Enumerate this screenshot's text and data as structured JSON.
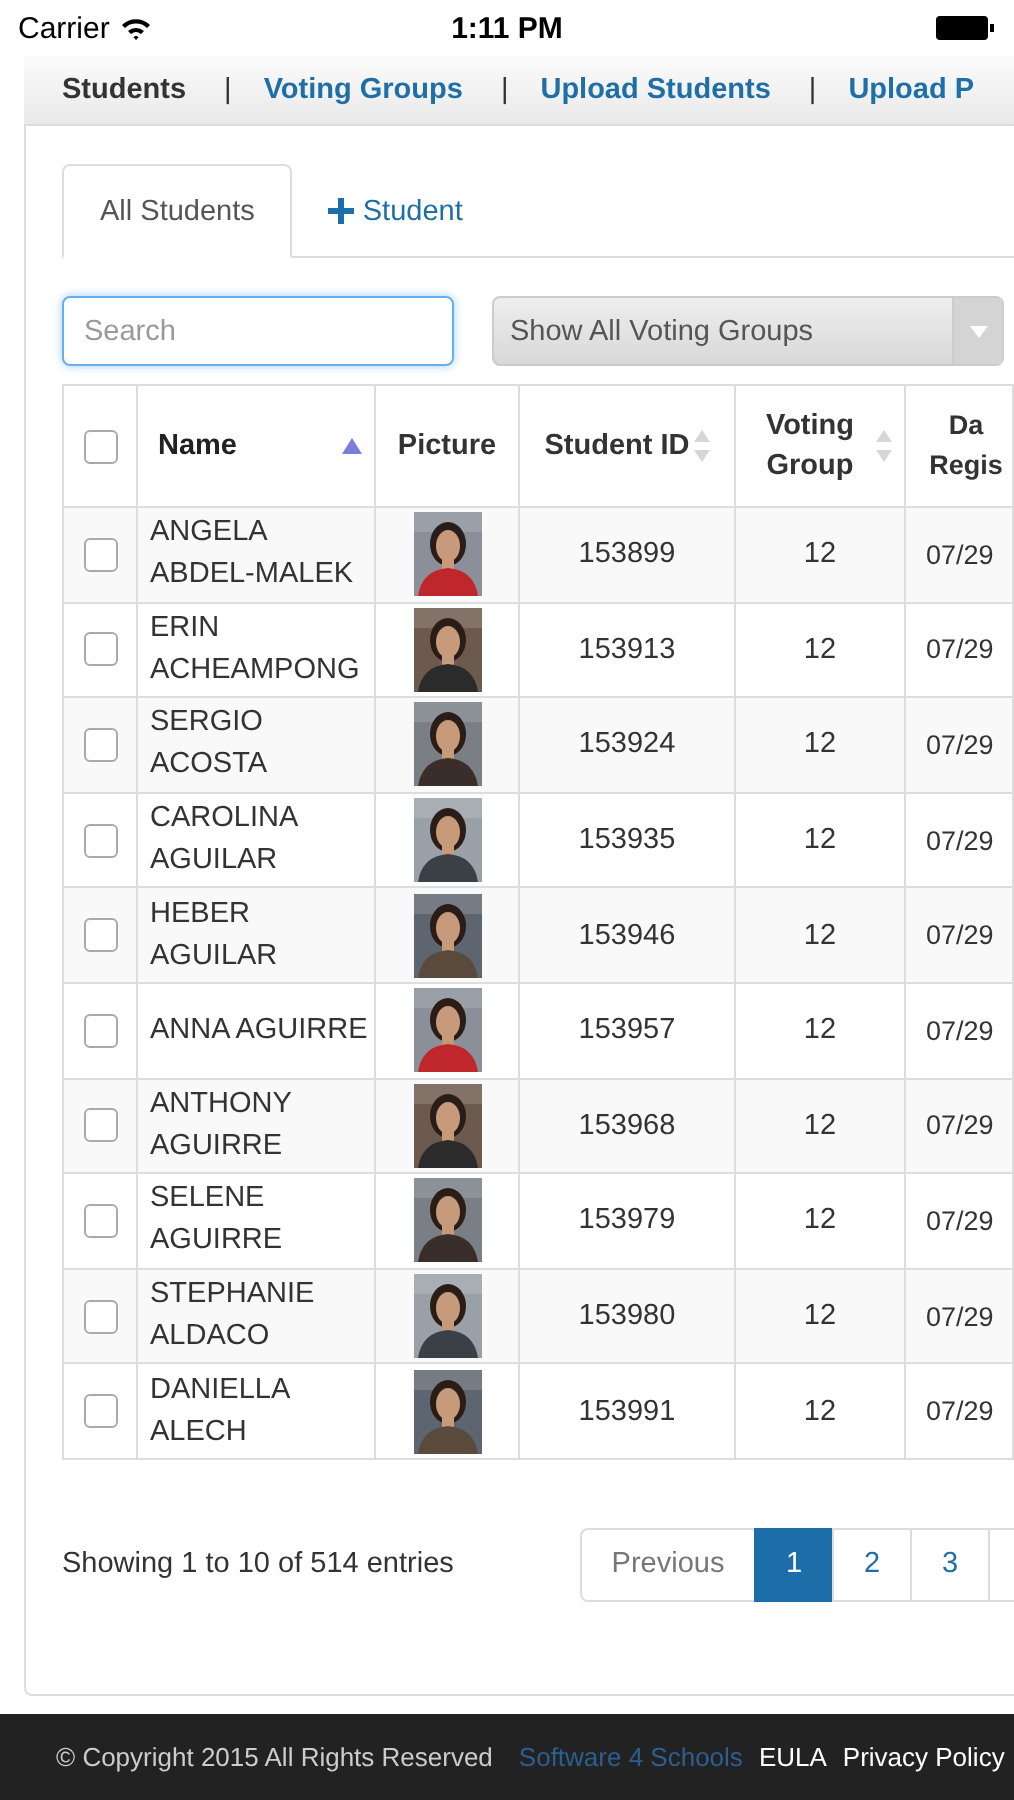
{
  "status_bar": {
    "carrier": "Carrier",
    "time": "1:11 PM"
  },
  "nav": [
    {
      "label": "Students",
      "selected": true
    },
    {
      "label": "Voting Groups",
      "selected": false
    },
    {
      "label": "Upload Students",
      "selected": false
    },
    {
      "label": "Upload P",
      "selected": false
    }
  ],
  "nav_separator": "|",
  "tabs": [
    {
      "label": "All Students",
      "selected": true,
      "kind": "plain"
    },
    {
      "label": "Student",
      "selected": false,
      "kind": "add"
    }
  ],
  "search": {
    "placeholder": "Search"
  },
  "group_select": {
    "value": "Show All Voting Groups"
  },
  "table": {
    "select_all_checked": false,
    "columns": [
      {
        "label": "Name",
        "sortable": true,
        "sorted": true
      },
      {
        "label": "Picture"
      },
      {
        "label": "Student ID",
        "sortable": true,
        "sorted": false
      },
      {
        "label": "Voting Group",
        "sortable": true,
        "sorted": false
      },
      {
        "label": "Da Regis"
      }
    ],
    "rows": [
      {
        "checked": false,
        "name": "ANGELA ABDEL-MALEK",
        "student_id": "153899",
        "voting_group": "12",
        "date": "07/29"
      },
      {
        "checked": false,
        "name": "ERIN ACHEAMPONG",
        "student_id": "153913",
        "voting_group": "12",
        "date": "07/29"
      },
      {
        "checked": false,
        "name": "SERGIO ACOSTA",
        "student_id": "153924",
        "voting_group": "12",
        "date": "07/29"
      },
      {
        "checked": false,
        "name": "CAROLINA AGUILAR",
        "student_id": "153935",
        "voting_group": "12",
        "date": "07/29"
      },
      {
        "checked": false,
        "name": "HEBER AGUILAR",
        "student_id": "153946",
        "voting_group": "12",
        "date": "07/29"
      },
      {
        "checked": false,
        "name": "ANNA AGUIRRE",
        "student_id": "153957",
        "voting_group": "12",
        "date": "07/29"
      },
      {
        "checked": false,
        "name": "ANTHONY AGUIRRE",
        "student_id": "153968",
        "voting_group": "12",
        "date": "07/29"
      },
      {
        "checked": false,
        "name": "SELENE AGUIRRE",
        "student_id": "153979",
        "voting_group": "12",
        "date": "07/29"
      },
      {
        "checked": false,
        "name": "STEPHANIE ALDACO",
        "student_id": "153980",
        "voting_group": "12",
        "date": "07/29"
      },
      {
        "checked": false,
        "name": "DANIELLA ALECH",
        "student_id": "153991",
        "voting_group": "12",
        "date": "07/29"
      }
    ]
  },
  "summary": "Showing 1 to 10 of 514 entries",
  "pagination": {
    "previous": "Previous",
    "pages": [
      {
        "label": "1",
        "selected": true
      },
      {
        "label": "2",
        "selected": false
      },
      {
        "label": "3",
        "selected": false
      }
    ]
  },
  "footer": {
    "copyright": "© Copyright 2015 All Rights Reserved",
    "brand_link": "Software 4 Schools",
    "links": [
      "EULA",
      "Privacy Policy"
    ]
  }
}
